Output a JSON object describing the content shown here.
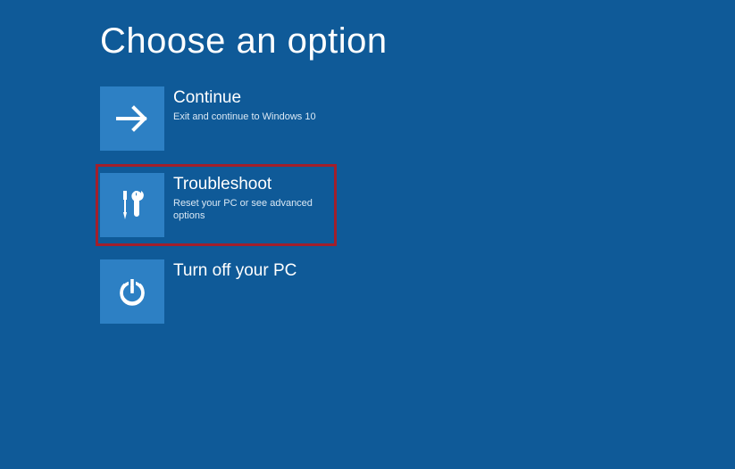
{
  "title": "Choose an option",
  "options": [
    {
      "title": "Continue",
      "desc": "Exit and continue to Windows 10"
    },
    {
      "title": "Troubleshoot",
      "desc": "Reset your PC or see advanced options"
    },
    {
      "title": "Turn off your PC",
      "desc": ""
    }
  ],
  "colors": {
    "background": "#0f5a98",
    "tile": "#2d80c4",
    "highlight": "#a21f2b"
  }
}
